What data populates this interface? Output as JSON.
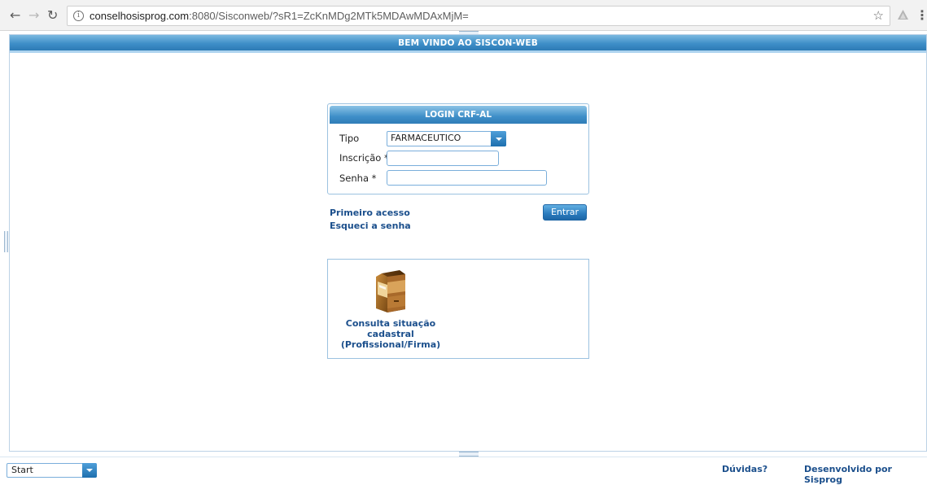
{
  "browser": {
    "url_host": "conselhosisprog.com",
    "url_rest": ":8080/Sisconweb/?sR1=ZcKnMDg2MTk5MDAwMDAxMjM=",
    "icons": [
      "back-arrow-icon",
      "forward-arrow-icon",
      "reload-icon",
      "info-icon",
      "star-icon",
      "extension-icon",
      "menu-icon"
    ]
  },
  "app": {
    "header_title": "BEM VINDO AO SISCON-WEB"
  },
  "login": {
    "title": "LOGIN CRF-AL",
    "tipo_label": "Tipo",
    "tipo_value": "FARMACEUTICO",
    "inscricao_label": "Inscrição *",
    "inscricao_value": "",
    "senha_label": "Senha *",
    "senha_value": "",
    "primeiro_acesso": "Primeiro acesso",
    "esqueci_senha": "Esqueci a senha",
    "entrar": "Entrar"
  },
  "consulta": {
    "label_line1": "Consulta situação",
    "label_line2": "cadastral",
    "label_line3": "(Profissional/Firma)",
    "icon": "file-cabinet-icon"
  },
  "footer": {
    "start_value": "Start",
    "duvidas": "Dúvidas?",
    "desenvolvido": "Desenvolvido por Sisprog"
  },
  "colors": {
    "accent": "#2c7ab5",
    "link": "#1b4f8c",
    "border": "#9cc2e0"
  }
}
